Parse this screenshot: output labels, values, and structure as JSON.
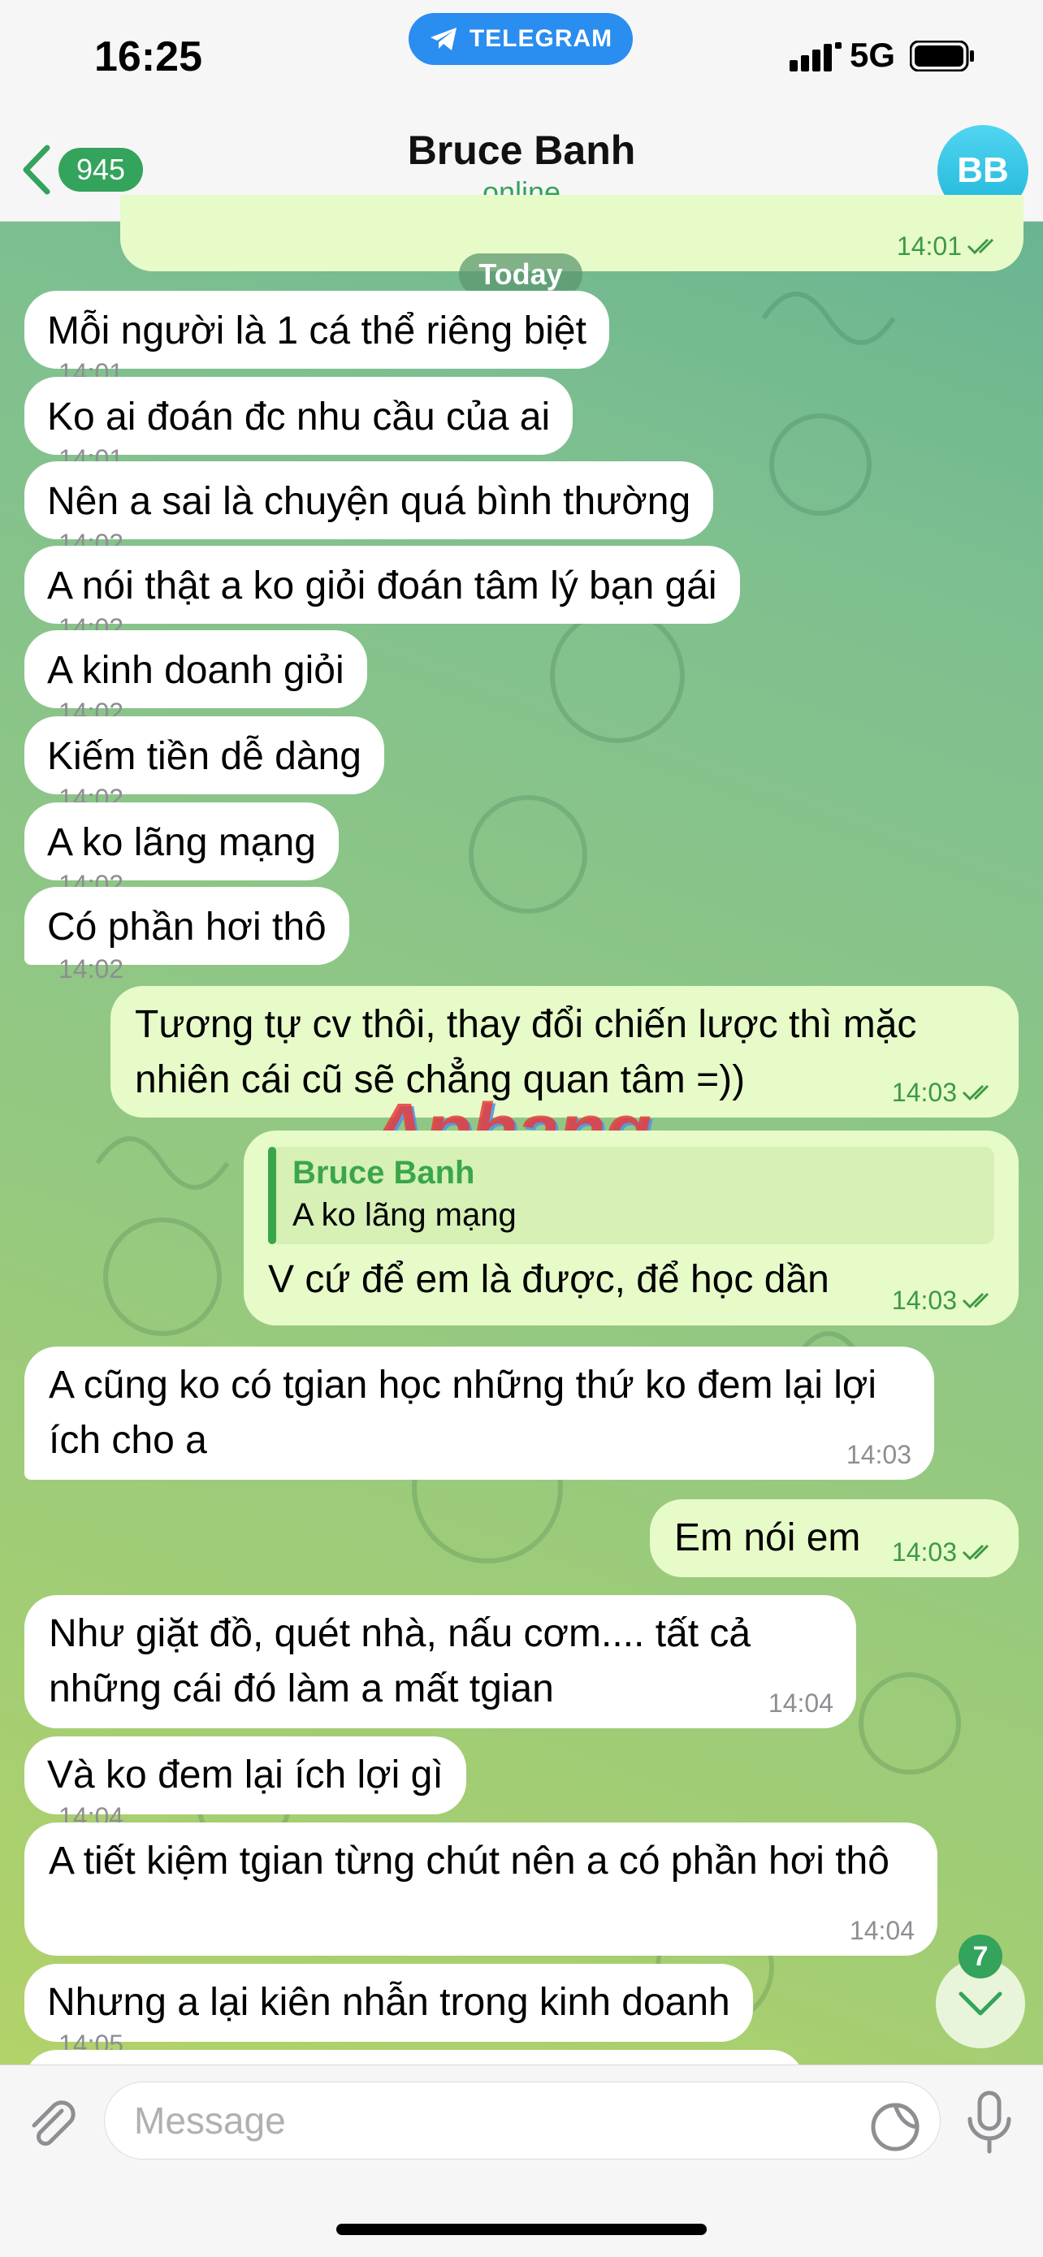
{
  "status_bar": {
    "time": "16:25",
    "app_pill": "TELEGRAM",
    "network": "5G"
  },
  "header": {
    "unread_count": "945",
    "contact_name": "Bruce Banh",
    "status": "online",
    "avatar_initials": "BB"
  },
  "date_separator": "Today",
  "prev_message_time": "14:01",
  "messages": [
    {
      "text": "Mỗi người là 1 cá thể riêng biệt",
      "time": "14:01"
    },
    {
      "text": "Ko ai đoán đc nhu cầu của ai",
      "time": "14:01"
    },
    {
      "text": "Nên a sai là chuyện quá bình thường",
      "time": "14:02"
    },
    {
      "text": "A nói thật a ko giỏi đoán tâm lý bạn gái",
      "time": "14:02"
    },
    {
      "text": "A kinh doanh giỏi",
      "time": "14:02"
    },
    {
      "text": "Kiếm tiền dễ dàng",
      "time": "14:02"
    },
    {
      "text": "A ko lãng mạng",
      "time": "14:02"
    },
    {
      "text": "Có phần hơi thô",
      "time": "14:02"
    },
    {
      "text": "Tương tự cv thôi, thay đổi chiến lược thì mặc nhiên cái cũ sẽ chẳng quan tâm =))",
      "time": "14:03"
    },
    {
      "text": "V cứ để em là được, để học dần",
      "time": "14:03",
      "reply_name": "Bruce Banh",
      "reply_text": "A ko lãng mạng"
    },
    {
      "text": "A cũng ko có tgian học những thứ ko đem lại lợi ích cho a",
      "time": "14:03"
    },
    {
      "text": "Em nói em",
      "time": "14:03"
    },
    {
      "text": "Như giặt đồ, quét nhà, nấu cơm.... tất cả những cái đó làm a mất tgian",
      "time": "14:04"
    },
    {
      "text": "Và ko đem lại ích lợi gì",
      "time": "14:04"
    },
    {
      "text": "A tiết kiệm tgian từng chút nên a có phần hơi thô",
      "time": "14:04"
    },
    {
      "text": "Nhưng a lại kiên nhẫn trong kinh doanh",
      "time": "14:05"
    }
  ],
  "watermark": "Aphang",
  "scroll_unread": "7",
  "input": {
    "placeholder": "Message"
  }
}
